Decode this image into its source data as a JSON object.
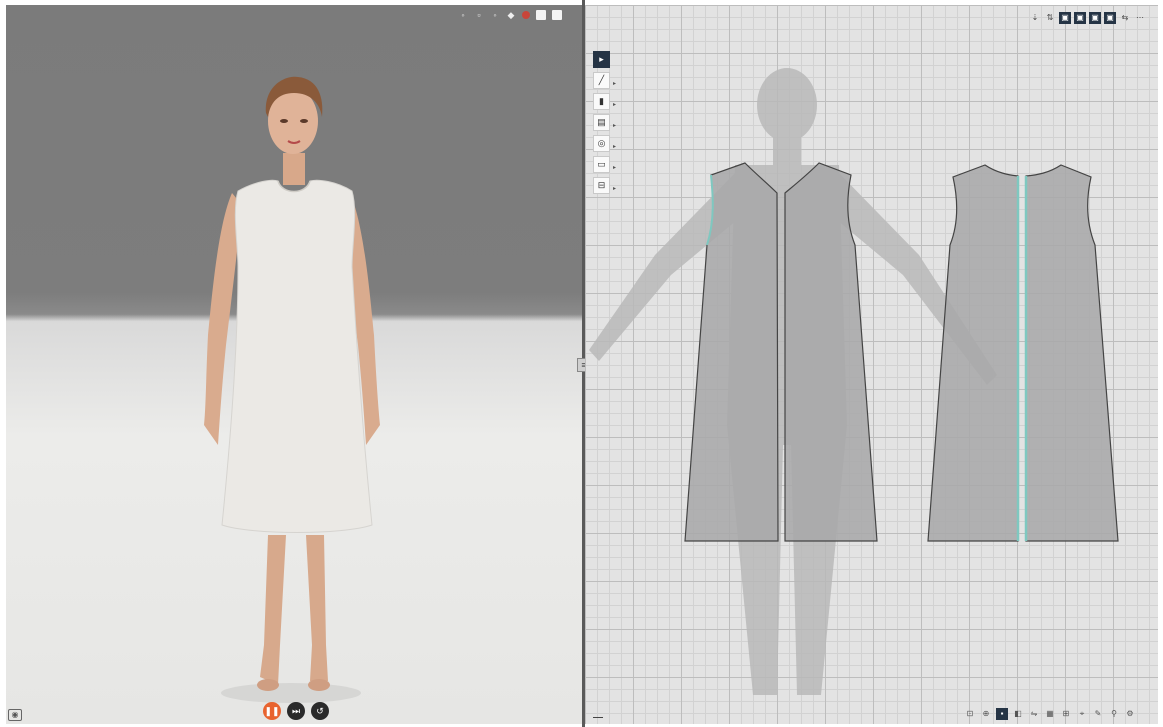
{
  "colors": {
    "accent": "#e8632f",
    "active_tool": "#253445",
    "pattern_fill": "#a9a9aa",
    "pattern_outline": "#444444",
    "selected_edge": "#7fc8c0",
    "garment": "#ebe9e5"
  },
  "viewport_3d": {
    "toolbar_icons": [
      "pin-icon",
      "display-icon",
      "texture-icon",
      "color-icon",
      "record-icon",
      "screenshot-icon",
      "layers-icon"
    ],
    "sim_controls": [
      {
        "name": "simulation-play-button",
        "icon": "pause-icon",
        "glyph": "❚❚"
      },
      {
        "name": "simulation-step-button",
        "icon": "step-icon",
        "glyph": "⏭"
      },
      {
        "name": "simulation-reset-button",
        "icon": "reset-icon",
        "glyph": "↺"
      }
    ],
    "camera_glyph": "◉"
  },
  "viewport_2d": {
    "top_tools": [
      {
        "name": "2d-select-mode",
        "glyph": "⇣",
        "dark": false
      },
      {
        "name": "2d-transform-mode",
        "glyph": "⇅",
        "dark": false
      },
      {
        "name": "2d-view-thumbnail",
        "glyph": "▣",
        "dark": true
      },
      {
        "name": "2d-view-grading",
        "glyph": "▣",
        "dark": true
      },
      {
        "name": "2d-view-avatar",
        "glyph": "▣",
        "dark": true
      },
      {
        "name": "2d-view-piece",
        "glyph": "▣",
        "dark": true
      },
      {
        "name": "2d-view-sewing",
        "glyph": "⇆",
        "dark": false
      },
      {
        "name": "2d-view-more",
        "glyph": "⋯",
        "dark": false
      }
    ],
    "side_tools": [
      {
        "name": "select-tool",
        "glyph": "▸",
        "active": true,
        "caret": false
      },
      {
        "name": "line-tool",
        "glyph": "╱",
        "active": false,
        "caret": true
      },
      {
        "name": "segment-tool",
        "glyph": "▮",
        "active": false,
        "caret": true
      },
      {
        "name": "pattern-tool",
        "glyph": "▤",
        "active": false,
        "caret": true
      },
      {
        "name": "circle-tool",
        "glyph": "◎",
        "active": false,
        "caret": true
      },
      {
        "name": "sewing-tool",
        "glyph": "▭",
        "active": false,
        "caret": true
      },
      {
        "name": "pin-tool",
        "glyph": "⊟",
        "active": false,
        "caret": true
      }
    ],
    "bottom_tools": [
      {
        "name": "fit-view-button",
        "glyph": "⊡",
        "dark": false
      },
      {
        "name": "zoom-in-button",
        "glyph": "⊕",
        "dark": false
      },
      {
        "name": "view-mode-button",
        "glyph": "▪",
        "dark": true
      },
      {
        "name": "fill-button",
        "glyph": "◧",
        "dark": false
      },
      {
        "name": "mirror-button",
        "glyph": "⇋",
        "dark": false
      },
      {
        "name": "grid-button",
        "glyph": "▦",
        "dark": false
      },
      {
        "name": "guide-button",
        "glyph": "⊞",
        "dark": false
      },
      {
        "name": "measure-button",
        "glyph": "⌖",
        "dark": false
      },
      {
        "name": "pen-button",
        "glyph": "✎",
        "dark": false
      },
      {
        "name": "zoom-button",
        "glyph": "⚲",
        "dark": false
      },
      {
        "name": "settings-button",
        "glyph": "⚙",
        "dark": false
      }
    ],
    "splitter_glyph": "≡"
  }
}
